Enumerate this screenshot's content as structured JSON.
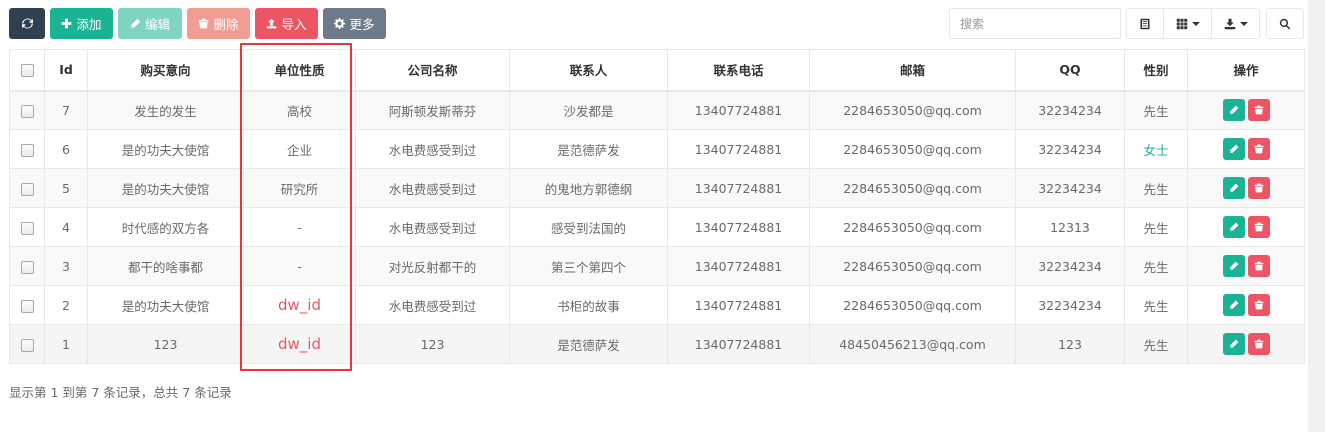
{
  "toolbar": {
    "refresh_icon": "refresh-icon",
    "add_label": "添加",
    "edit_label": "编辑",
    "delete_label": "删除",
    "import_label": "导入",
    "more_label": "更多"
  },
  "search": {
    "placeholder": "搜索"
  },
  "colors": {
    "primary": "#1ab394",
    "danger": "#ed5565",
    "dark": "#2f4050",
    "highlight": "#e03a3a"
  },
  "table": {
    "headers": [
      "Id",
      "购买意向",
      "单位性质",
      "公司名称",
      "联系人",
      "联系电话",
      "邮箱",
      "QQ",
      "性别",
      "操作"
    ],
    "rows": [
      {
        "id": "7",
        "intent": "发生的发生",
        "unit_type": "高校",
        "company": "阿斯顿发斯蒂芬",
        "contact": "沙发都是",
        "phone": "13407724881",
        "email": "2284653050@qq.com",
        "qq": "32234234",
        "gender": "先生"
      },
      {
        "id": "6",
        "intent": "是的功夫大使馆",
        "unit_type": "企业",
        "company": "水电费感受到过",
        "contact": "是范德萨发",
        "phone": "13407724881",
        "email": "2284653050@qq.com",
        "qq": "32234234",
        "gender": "女士"
      },
      {
        "id": "5",
        "intent": "是的功夫大使馆",
        "unit_type": "研究所",
        "company": "水电费感受到过",
        "contact": "的鬼地方郭德纲",
        "phone": "13407724881",
        "email": "2284653050@qq.com",
        "qq": "32234234",
        "gender": "先生"
      },
      {
        "id": "4",
        "intent": "时代感的双方各",
        "unit_type": "-",
        "company": "水电费感受到过",
        "contact": "感受到法国的",
        "phone": "13407724881",
        "email": "2284653050@qq.com",
        "qq": "12313",
        "gender": "先生"
      },
      {
        "id": "3",
        "intent": "都干的啥事都",
        "unit_type": "-",
        "company": "对光反射都干的",
        "contact": "第三个第四个",
        "phone": "13407724881",
        "email": "2284653050@qq.com",
        "qq": "32234234",
        "gender": "先生"
      },
      {
        "id": "2",
        "intent": "是的功夫大使馆",
        "unit_type": "dw_id",
        "company": "水电费感受到过",
        "contact": "书柜的故事",
        "phone": "13407724881",
        "email": "2284653050@qq.com",
        "qq": "32234234",
        "gender": "先生"
      },
      {
        "id": "1",
        "intent": "123",
        "unit_type": "dw_id",
        "company": "123",
        "contact": "是范德萨发",
        "phone": "13407724881",
        "email": "48450456213@qq.com",
        "qq": "123",
        "gender": "先生"
      }
    ]
  },
  "footer": {
    "summary": "显示第 1 到第 7 条记录，总共 7 条记录"
  }
}
